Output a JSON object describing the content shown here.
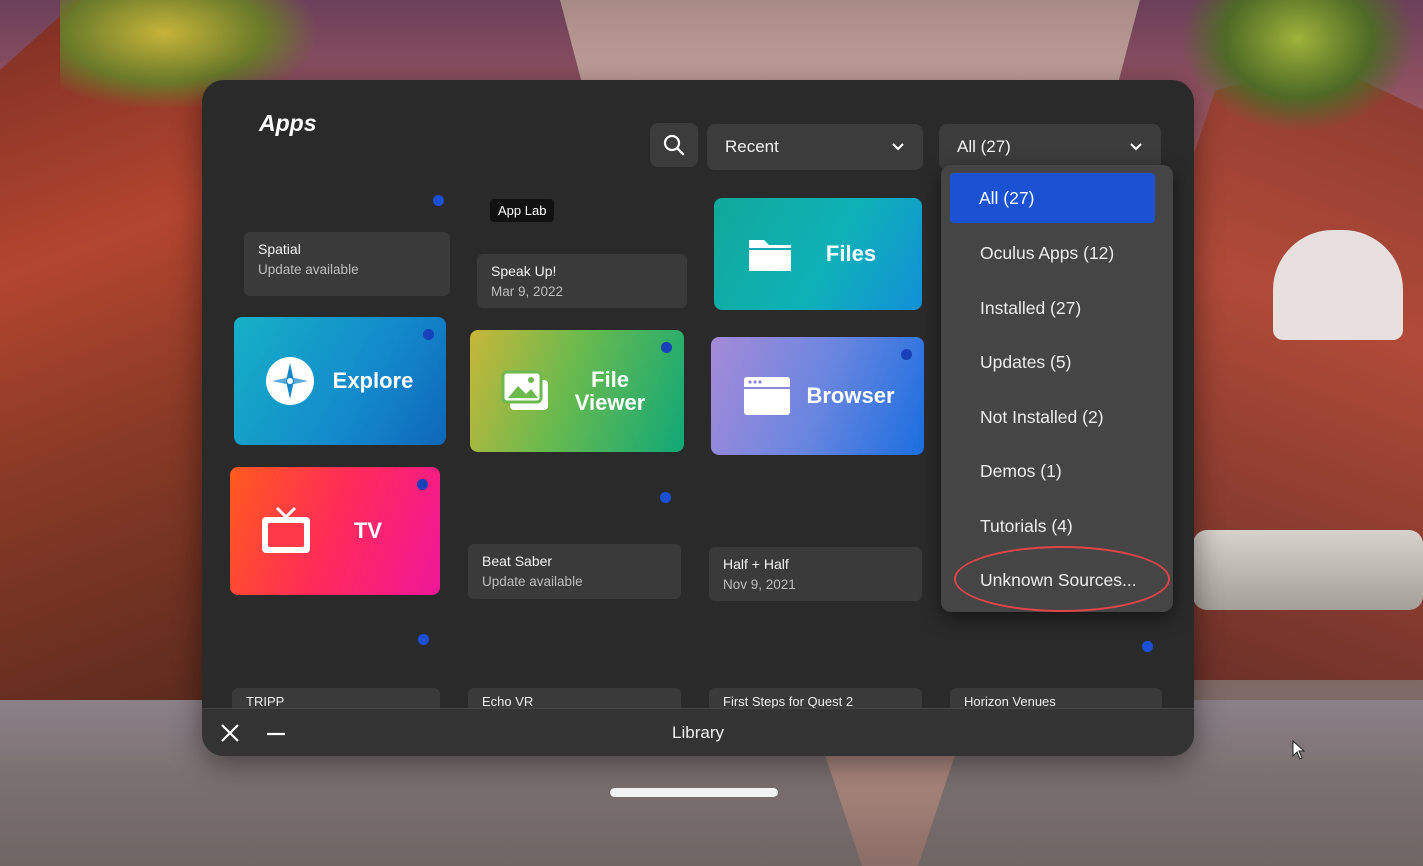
{
  "panel": {
    "title": "Apps"
  },
  "toolbar": {
    "search_icon": "search-icon",
    "sort_value": "Recent",
    "filter_value": "All (27)"
  },
  "filter_dropdown": {
    "items": [
      {
        "label": "All (27)",
        "selected": true
      },
      {
        "label": "Oculus Apps (12)",
        "selected": false
      },
      {
        "label": "Installed (27)",
        "selected": false
      },
      {
        "label": "Updates (5)",
        "selected": false
      },
      {
        "label": "Not Installed (2)",
        "selected": false
      },
      {
        "label": "Demos (1)",
        "selected": false
      },
      {
        "label": "Tutorials (4)",
        "selected": false
      },
      {
        "label": "Unknown Sources...",
        "selected": false
      }
    ],
    "highlight_color": "#1a52d3",
    "annotation_color": "#e0444a"
  },
  "apps": {
    "spatial": {
      "name": "Spatial",
      "status": "Update available"
    },
    "speak_up": {
      "badge": "App Lab",
      "name": "Speak Up!",
      "date": "Mar 9, 2022"
    },
    "files": {
      "label": "Files"
    },
    "explore": {
      "label": "Explore"
    },
    "file_viewer": {
      "label_line1": "File",
      "label_line2": "Viewer"
    },
    "browser": {
      "label": "Browser"
    },
    "tv": {
      "label": "TV"
    },
    "beat_saber": {
      "name": "Beat Saber",
      "status": "Update available"
    },
    "half_half": {
      "name": "Half + Half",
      "date": "Nov 9, 2021"
    },
    "row4": [
      "TRIPP",
      "Echo VR",
      "First Steps for Quest 2",
      "Horizon Venues"
    ]
  },
  "bottom_bar": {
    "title": "Library"
  }
}
